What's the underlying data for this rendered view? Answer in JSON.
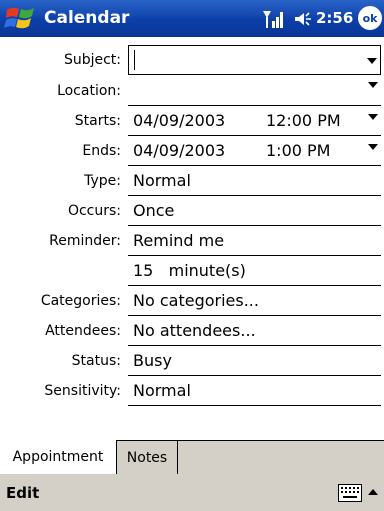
{
  "titlebar": {
    "app_title": "Calendar",
    "clock": "2:56",
    "ok_label": "ok"
  },
  "form": {
    "subject": {
      "label": "Subject:",
      "value": ""
    },
    "location": {
      "label": "Location:",
      "value": ""
    },
    "starts": {
      "label": "Starts:",
      "date": "04/09/2003",
      "time": "12:00 PM"
    },
    "ends": {
      "label": "Ends:",
      "date": "04/09/2003",
      "time": "1:00 PM"
    },
    "type": {
      "label": "Type:",
      "value": "Normal"
    },
    "occurs": {
      "label": "Occurs:",
      "value": "Once"
    },
    "reminder": {
      "label": "Reminder:",
      "value": "Remind me"
    },
    "reminder_interval": {
      "value": "15   minute(s)"
    },
    "categories": {
      "label": "Categories:",
      "value": "No categories..."
    },
    "attendees": {
      "label": "Attendees:",
      "value": "No attendees..."
    },
    "status": {
      "label": "Status:",
      "value": "Busy"
    },
    "sensitivity": {
      "label": "Sensitivity:",
      "value": "Normal"
    }
  },
  "tabs": [
    {
      "label": "Appointment",
      "active": true
    },
    {
      "label": "Notes",
      "active": false
    }
  ],
  "menubar": {
    "edit_label": "Edit"
  },
  "colors": {
    "titlebar": "#0c3fa8",
    "menubar": "#d4d0c8"
  }
}
